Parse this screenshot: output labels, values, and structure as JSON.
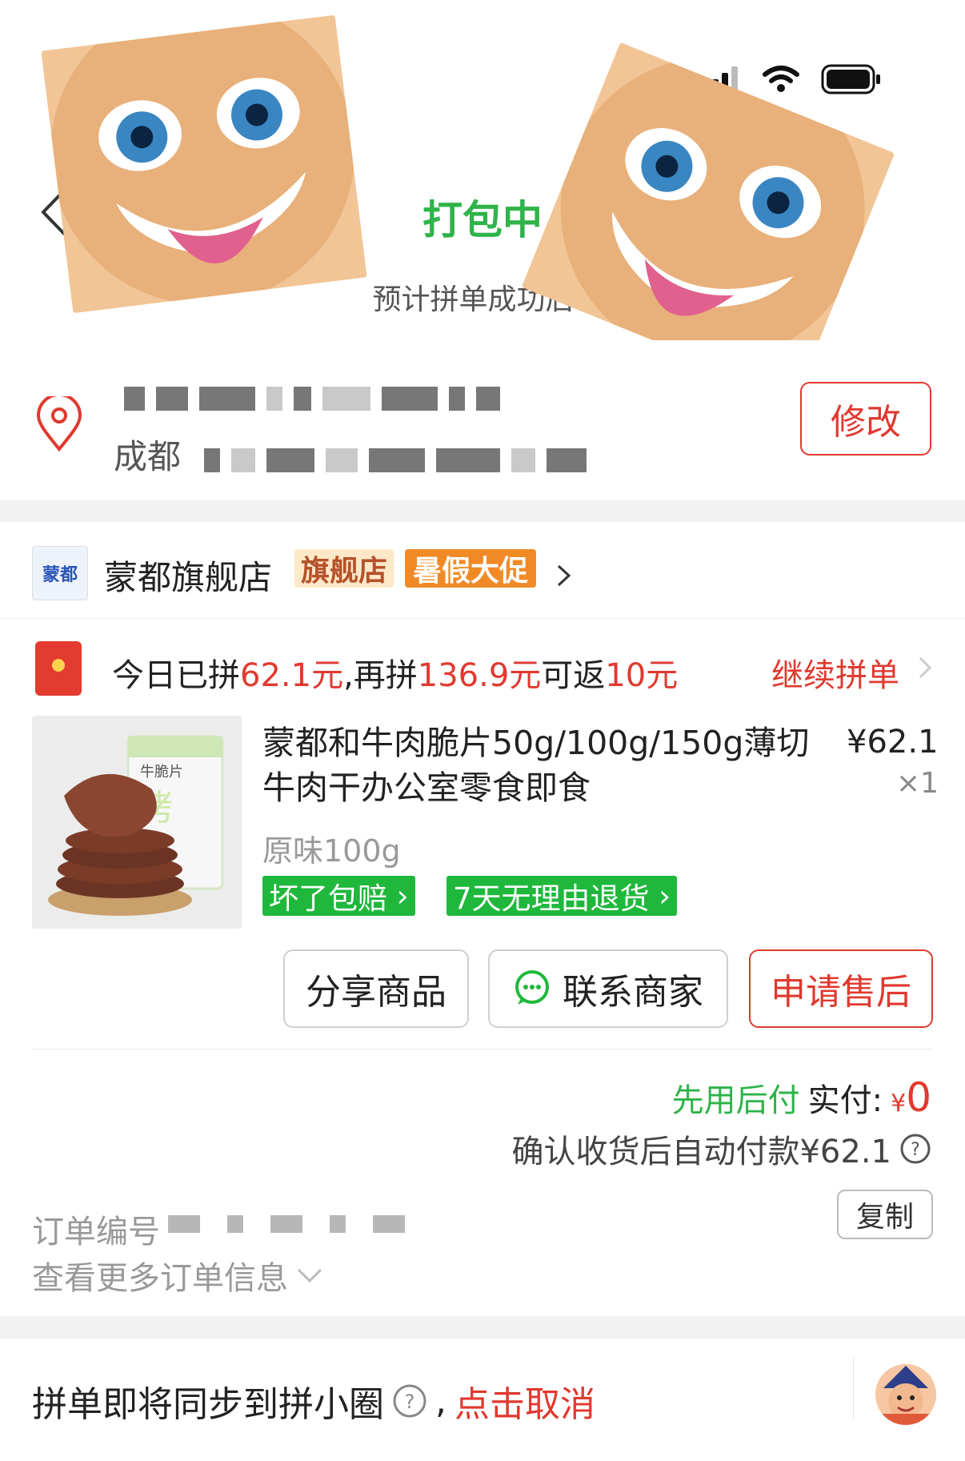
{
  "header": {
    "title": "打包中",
    "subtitle": "预计拼单成功后2"
  },
  "address": {
    "city_prefix": "成都",
    "modify_label": "修改"
  },
  "shop": {
    "logo_text": "蒙都",
    "name": "蒙都旗舰店",
    "tag_flagship": "旗舰店",
    "tag_promo": "暑假大促"
  },
  "group_buy": {
    "text_1": "今日已拼",
    "amount_done": "62.1元",
    "text_2": ",再拼",
    "amount_needed": "136.9元",
    "text_3": "可返",
    "rebate": "10元",
    "continue_label": "继续拼单"
  },
  "product": {
    "title": "蒙都和牛肉脆片50g/100g/150g薄切牛肉干办公室零食即食",
    "price": "¥62.1",
    "quantity": "×1",
    "spec": "原味100g",
    "badge_1": "坏了包赔",
    "badge_2": "7天无理由退货",
    "package_text": "牛脆片"
  },
  "actions": {
    "share": "分享商品",
    "contact": "联系商家",
    "after_sale": "申请售后"
  },
  "payment": {
    "method": "先用后付",
    "paid_label": "实付:",
    "currency": "¥",
    "paid_amount": "0",
    "note": "确认收货后自动付款¥62.1"
  },
  "order": {
    "number_label": "订单编号",
    "copy_label": "复制",
    "more_label": "查看更多订单信息"
  },
  "bottom": {
    "sync_text": "拼单即将同步到拼小圈",
    "comma": ",",
    "cancel_label": "点击取消"
  },
  "colors": {
    "brand_red": "#e0392f",
    "status_green": "#2fb34a",
    "badge_green": "#1fb83c",
    "promo_orange": "#f08a27"
  }
}
